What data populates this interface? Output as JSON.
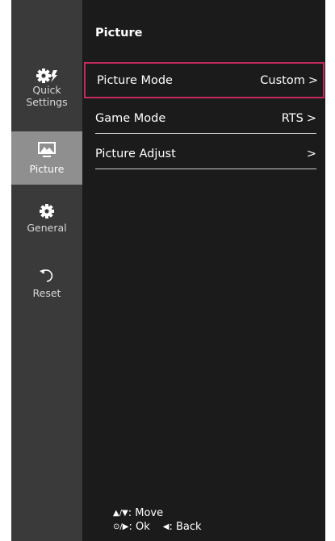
{
  "sidebar": {
    "items": [
      {
        "label_top": "Quick",
        "label_bottom": "Settings",
        "icon": "quick-settings-icon"
      },
      {
        "label": "Picture",
        "icon": "picture-icon",
        "active": true
      },
      {
        "label": "General",
        "icon": "general-gear-icon"
      },
      {
        "label": "Reset",
        "icon": "reset-icon"
      }
    ]
  },
  "main": {
    "title": "Picture",
    "rows": [
      {
        "label": "Picture Mode",
        "value": "Custom",
        "chevron": ">",
        "selected": true
      },
      {
        "label": "Game Mode",
        "value": "RTS",
        "chevron": ">"
      },
      {
        "label": "Picture Adjust",
        "value": "",
        "chevron": ">"
      }
    ]
  },
  "footer": {
    "move_symbol": "▲/▼",
    "move_label": ": Move",
    "ok_symbol": "⊙/▶",
    "ok_label": ": Ok",
    "back_symbol": "◀",
    "back_label": ": Back"
  },
  "colors": {
    "panel_background": "#1b1b1b",
    "sidebar_background": "#3a3a3a",
    "active_item_background": "#8f8f8f",
    "selection_border": "#c42a5a",
    "text": "#ffffff"
  }
}
